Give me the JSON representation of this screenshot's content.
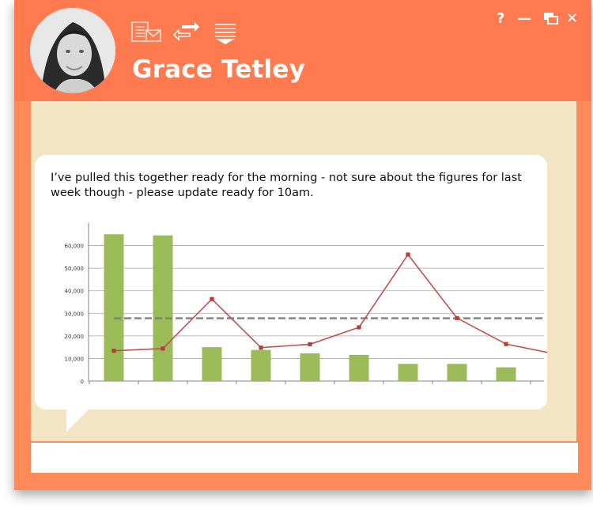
{
  "window": {
    "user_name": "Grace Tetley",
    "controls": {
      "help": "?",
      "minimize": "—",
      "close": "✕"
    },
    "colors": {
      "header": "#ff7b4f",
      "frame": "#ff8a5a",
      "content_bg": "#f3e6c4"
    }
  },
  "toolbar": {
    "icons": [
      "message-compose-icon",
      "swap-arrows-icon",
      "expand-menu-icon"
    ]
  },
  "message": {
    "text": "I’ve pulled this together ready for the morning - not sure about the figures for last week though - please update ready for 10am."
  },
  "reply": {
    "value": ""
  },
  "chart_data": {
    "type": "bar",
    "ylim": [
      0,
      70000
    ],
    "yticks": [
      0,
      10000,
      20000,
      30000,
      40000,
      50000,
      60000
    ],
    "ytick_labels": [
      "0",
      "10,000",
      "20,000",
      "30,000",
      "40,000",
      "50,000",
      "60,000"
    ],
    "grid": true,
    "series": [
      {
        "kind": "bar",
        "color": "#9bbb59",
        "values": [
          65000,
          64500,
          15000,
          13800,
          12300,
          11600,
          7600,
          7600,
          6100
        ]
      },
      {
        "kind": "line",
        "color": "#c0504d",
        "values": [
          13400,
          14400,
          36300,
          14800,
          16300,
          23800,
          56000,
          27900,
          16400,
          12000
        ]
      },
      {
        "kind": "dashed",
        "color": "#7f7f7f",
        "values": [
          27800
        ]
      }
    ]
  }
}
